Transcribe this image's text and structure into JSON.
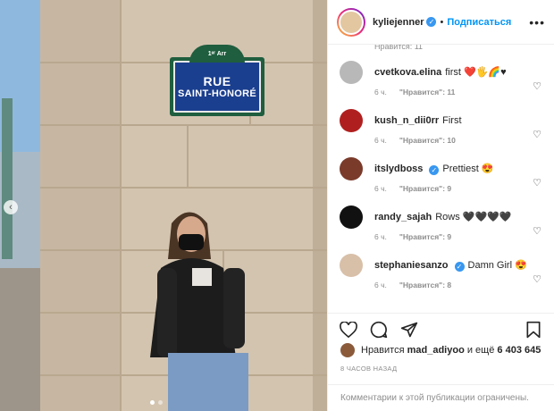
{
  "post": {
    "street_sign": {
      "top": "1ᵉʳ Arr",
      "line1": "RUE",
      "line2": "SAINT-HONORÉ"
    },
    "carousel": {
      "count": 2,
      "active": 0
    }
  },
  "header": {
    "username": "kyliejenner",
    "follow_label": "Подписаться",
    "more_label": "•••"
  },
  "partial_text": "Нравится: 11",
  "comments": [
    {
      "user": "cvetkova.elina",
      "text": "first ❤️🖐🌈♥",
      "time": "6 ч.",
      "likes": "\"Нравится\": 11",
      "verified": false,
      "avatar_color": "#b8b8b8"
    },
    {
      "user": "kush_n_dii0rr",
      "text": "First",
      "time": "6 ч.",
      "likes": "\"Нравится\": 10",
      "verified": false,
      "avatar_color": "#b01f1f"
    },
    {
      "user": "itslydboss",
      "text": "Prettiest 😍",
      "time": "6 ч.",
      "likes": "\"Нравится\": 9",
      "verified": true,
      "avatar_color": "#7a3b2b"
    },
    {
      "user": "randy_sajah",
      "text": "Rows 🖤🖤🖤🖤",
      "time": "6 ч.",
      "likes": "\"Нравится\": 9",
      "verified": false,
      "avatar_color": "#111111"
    },
    {
      "user": "stephaniesanzo",
      "text": "Damn Girl 😍",
      "time": "6 ч.",
      "likes": "\"Нравится\": 8",
      "verified": true,
      "avatar_color": "#d8bfa8"
    }
  ],
  "likes": {
    "prefix": "Нравится",
    "user": "mad_adiyoo",
    "middle": "и ещё",
    "count": "6 403 645"
  },
  "timestamp": "8 ЧАСОВ НАЗАД",
  "comments_closed": "Комментарии к этой публикации ограничены."
}
